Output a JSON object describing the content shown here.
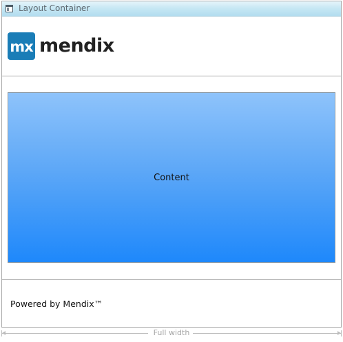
{
  "window": {
    "title": "Layout Container",
    "icon": "layout-container-icon"
  },
  "header": {
    "logo": {
      "badge_text": "mx",
      "wordmark": "mendix",
      "brand_color": "#1a7db7"
    }
  },
  "main": {
    "content_label": "Content",
    "gradient_top": "#8ec3fb",
    "gradient_bottom": "#1e88fb"
  },
  "footer": {
    "text": "Powered by Mendix™"
  },
  "width_indicator": {
    "label": "Full width"
  }
}
